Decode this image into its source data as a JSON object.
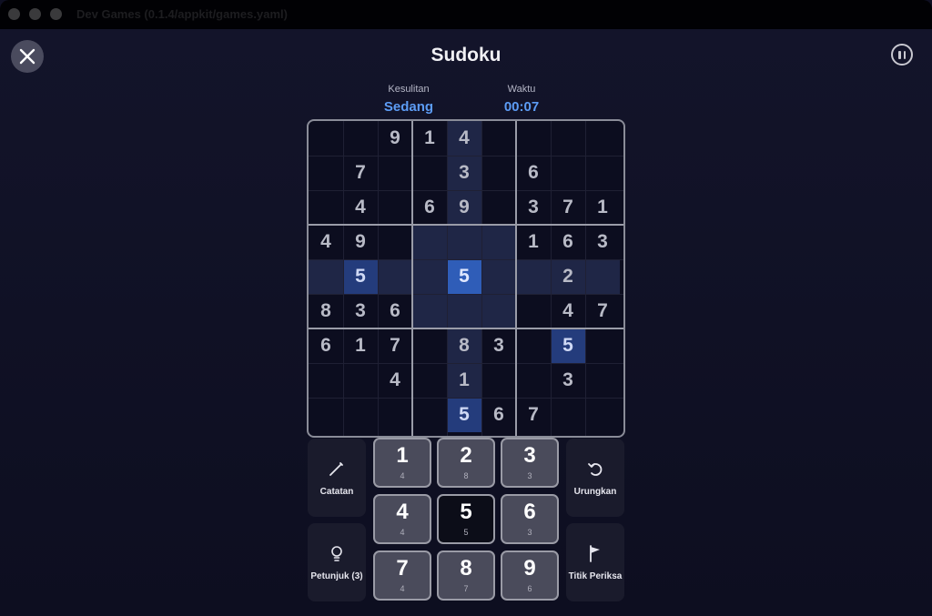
{
  "window": {
    "title": "Dev Games (0.1.4/appkit/games.yaml)"
  },
  "header": {
    "title": "Sudoku"
  },
  "stats": {
    "difficulty_label": "Kesulitan",
    "difficulty_value": "Sedang",
    "time_label": "Waktu",
    "time_value": "00:07"
  },
  "board": {
    "selected": [
      4,
      4
    ],
    "grid": [
      [
        0,
        0,
        9,
        1,
        4,
        0,
        0,
        0,
        0
      ],
      [
        0,
        7,
        0,
        0,
        3,
        0,
        6,
        0,
        0
      ],
      [
        0,
        4,
        0,
        6,
        9,
        0,
        3,
        7,
        1
      ],
      [
        4,
        9,
        0,
        0,
        0,
        0,
        1,
        6,
        3
      ],
      [
        0,
        5,
        0,
        0,
        5,
        0,
        0,
        2,
        0
      ],
      [
        8,
        3,
        6,
        0,
        0,
        0,
        0,
        4,
        7
      ],
      [
        6,
        1,
        7,
        0,
        8,
        3,
        0,
        5,
        0
      ],
      [
        0,
        0,
        4,
        0,
        1,
        0,
        0,
        3,
        0
      ],
      [
        0,
        0,
        0,
        0,
        5,
        6,
        7,
        0,
        0
      ]
    ]
  },
  "tools": {
    "notes_label": "Catatan",
    "undo_label": "Urungkan",
    "hint_label": "Petunjuk (3)",
    "checkpoint_label": "Titik Periksa"
  },
  "numpad": [
    {
      "digit": "1",
      "count": "4"
    },
    {
      "digit": "2",
      "count": "8"
    },
    {
      "digit": "3",
      "count": "3"
    },
    {
      "digit": "4",
      "count": "4"
    },
    {
      "digit": "5",
      "count": "5"
    },
    {
      "digit": "6",
      "count": "3"
    },
    {
      "digit": "7",
      "count": "4"
    },
    {
      "digit": "8",
      "count": "7"
    },
    {
      "digit": "9",
      "count": "6"
    }
  ],
  "colors": {
    "accent": "#5c9cf5",
    "selected_cell": "#2f5db8",
    "same_digit_cell": "#243c7c",
    "highlight_cell": "#1f2646",
    "background": "#0e0f22"
  },
  "icons": {
    "close": "close-icon",
    "pause": "pause-icon",
    "notes": "pencil-icon",
    "undo": "undo-icon",
    "hint": "lightbulb-icon",
    "checkpoint": "flag-icon"
  }
}
